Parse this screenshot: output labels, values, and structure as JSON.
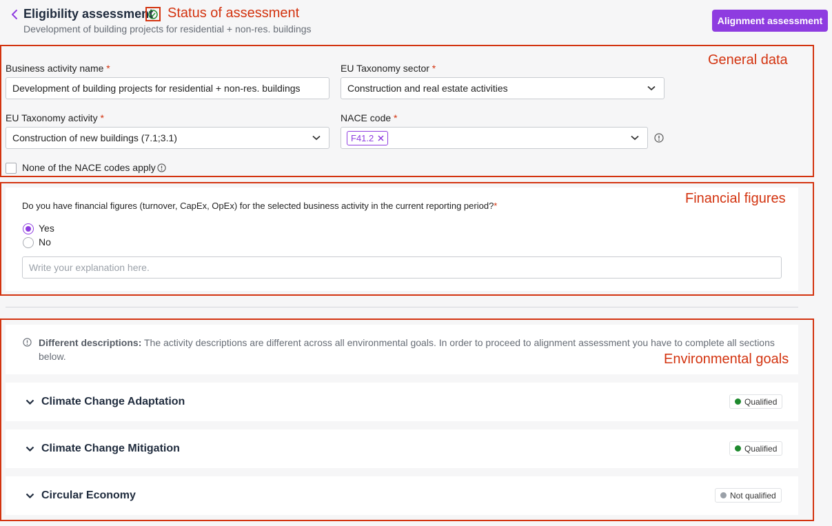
{
  "header": {
    "title": "Eligibility assessment",
    "subtitle": "Development of building projects for residential + non-res. buildings",
    "align_button": "Alignment assessment"
  },
  "annotations": {
    "status": "Status of assessment",
    "general": "General data",
    "financial": "Financial figures",
    "environmental": "Environmental goals"
  },
  "general": {
    "business_activity_label": "Business activity name",
    "business_activity_value": "Development of building projects for residential + non-res. buildings",
    "sector_label": "EU Taxonomy sector",
    "sector_value": "Construction and real estate activities",
    "activity_label": "EU Taxonomy activity",
    "activity_value": "Construction of new buildings (7.1;3.1)",
    "nace_label": "NACE code",
    "nace_chip": "F41.2",
    "none_apply_label": "None of the NACE codes apply",
    "required_mark": "*"
  },
  "financial": {
    "question": "Do you have financial figures (turnover, CapEx, OpEx) for the selected business activity in the current reporting period?",
    "required_mark": "*",
    "yes_label": "Yes",
    "no_label": "No",
    "selected": "Yes",
    "explanation_placeholder": "Write your explanation here."
  },
  "environmental": {
    "info_bold": "Different descriptions:",
    "info_text": " The activity descriptions are different across all environmental goals. In order to proceed to alignment assessment you have to complete all sections below.",
    "goals": [
      {
        "title": "Climate Change Adaptation",
        "status": "Qualified",
        "color": "#1f8a2e"
      },
      {
        "title": "Climate Change Mitigation",
        "status": "Qualified",
        "color": "#1f8a2e"
      },
      {
        "title": "Circular Economy",
        "status": "Not qualified",
        "color": "#9aa0a8"
      }
    ]
  },
  "colors": {
    "accent": "#8e3ce0",
    "annotation": "#d3330f",
    "success": "#1f8a2e"
  }
}
